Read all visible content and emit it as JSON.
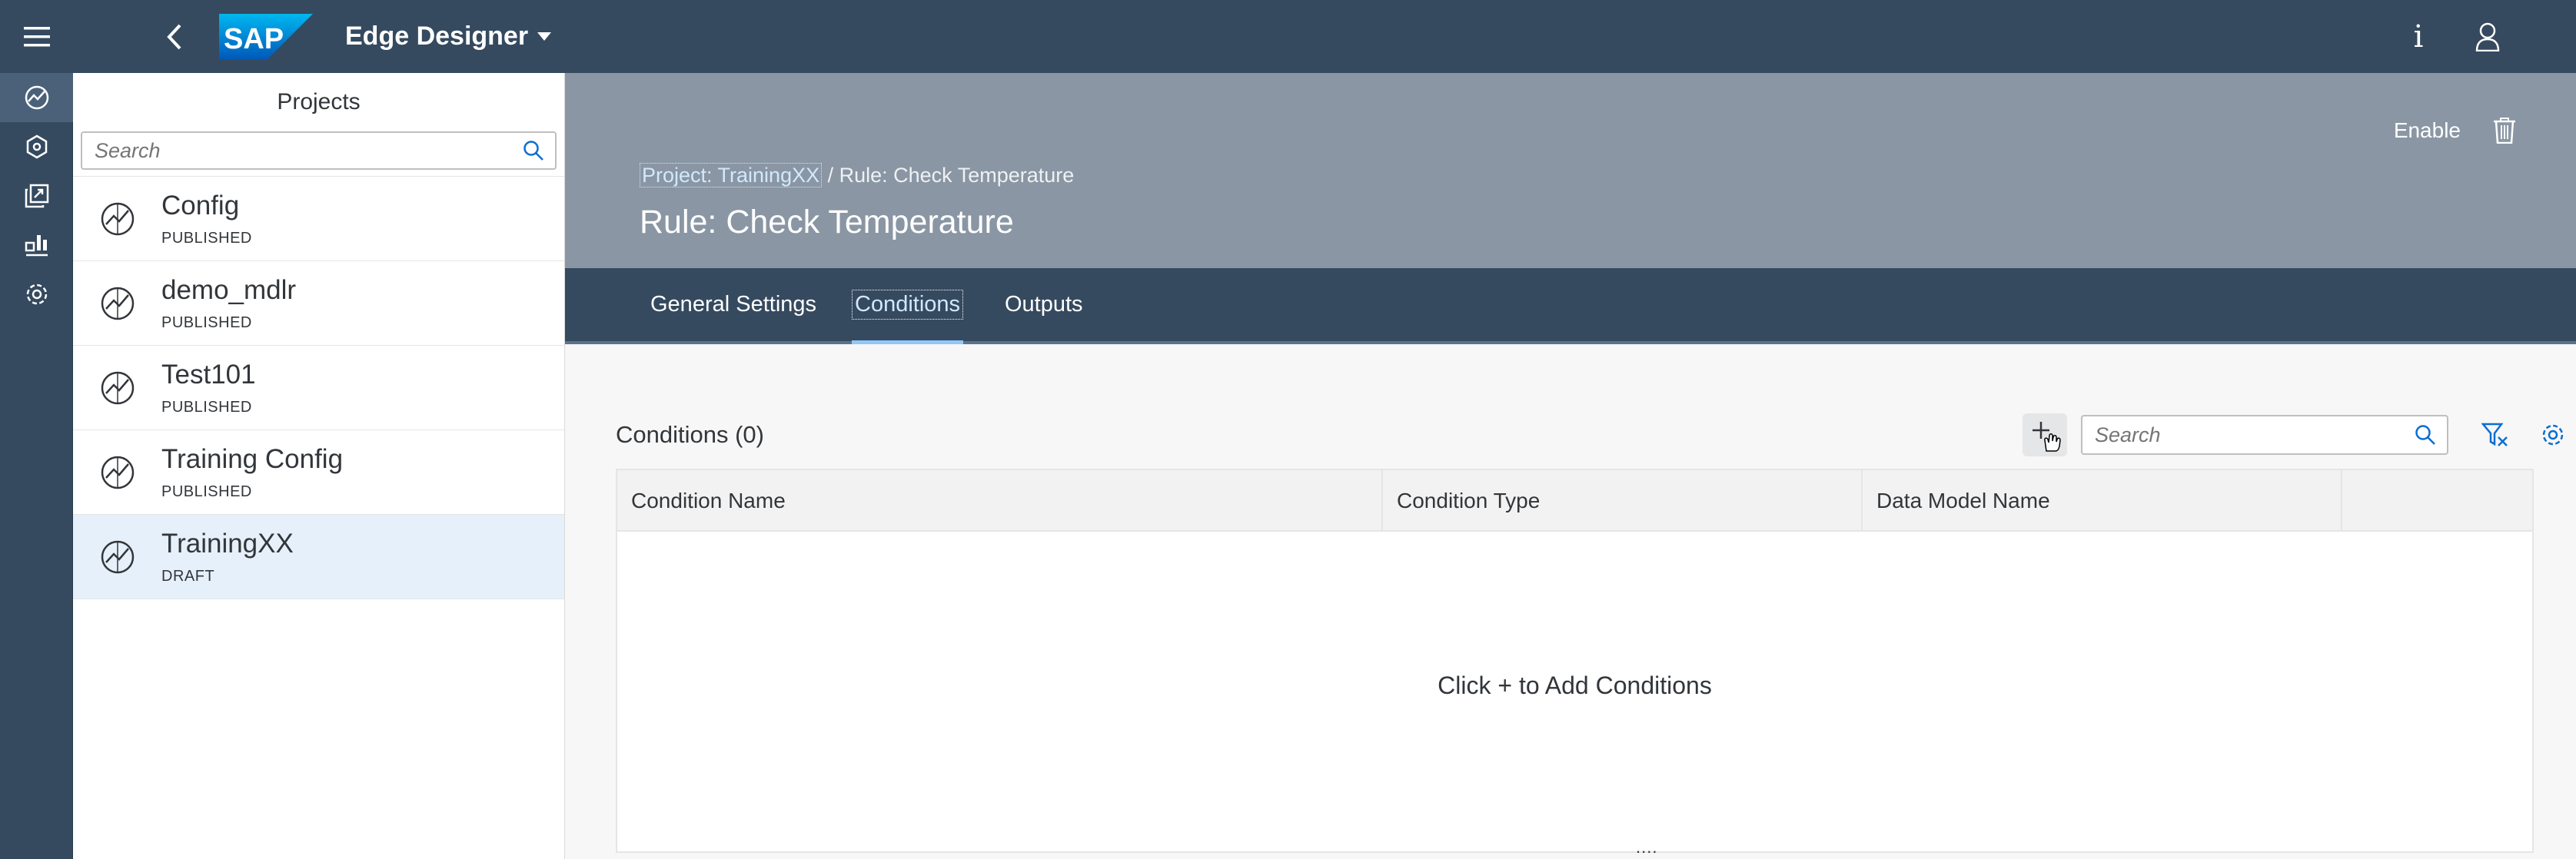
{
  "shell": {
    "app_title": "Edge Designer",
    "icons": [
      "hamburger-icon",
      "back-icon",
      "sap-logo",
      "info-icon",
      "user-icon"
    ]
  },
  "sidenav": {
    "items": [
      {
        "icon": "project-icon",
        "active": true
      },
      {
        "icon": "model-icon",
        "active": false
      },
      {
        "icon": "export-icon",
        "active": false
      },
      {
        "icon": "dashboard-icon",
        "active": false
      },
      {
        "icon": "settings-gear-icon",
        "active": false
      }
    ]
  },
  "projects": {
    "title": "Projects",
    "search_placeholder": "Search",
    "items": [
      {
        "name": "Config",
        "status": "PUBLISHED"
      },
      {
        "name": "demo_mdlr",
        "status": "PUBLISHED"
      },
      {
        "name": "Test101",
        "status": "PUBLISHED"
      },
      {
        "name": "Training Config",
        "status": "PUBLISHED"
      },
      {
        "name": "TrainingXX",
        "status": "DRAFT",
        "selected": true
      }
    ]
  },
  "header": {
    "breadcrumb_link": "Project: TrainingXX",
    "breadcrumb_rest": " / Rule: Check Temperature",
    "title": "Rule: Check Temperature",
    "enable_label": "Enable"
  },
  "tabs": [
    {
      "label": "General Settings"
    },
    {
      "label": "Conditions",
      "active": true
    },
    {
      "label": "Outputs"
    }
  ],
  "conditions": {
    "title": "Conditions (0)",
    "search_placeholder": "Search",
    "columns": [
      "Condition Name",
      "Condition Type",
      "Data Model Name",
      ""
    ],
    "empty_text": "Click + to Add Conditions",
    "grip": "...."
  },
  "colors": {
    "shell": "#354a5f",
    "header": "#8a96a3",
    "selected_row": "#e5f0fa",
    "tab_underline": "#91c8f6"
  }
}
